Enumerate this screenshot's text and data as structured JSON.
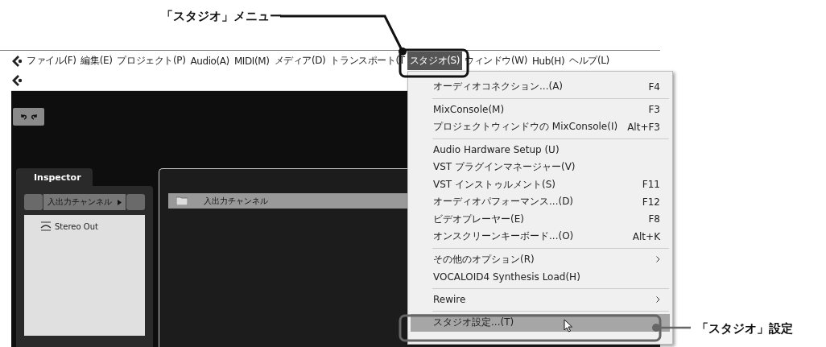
{
  "annotations": [
    {
      "text": "「スタジオ」メニュー"
    },
    {
      "text": "「スタジオ」設定"
    }
  ],
  "menubar": {
    "items": [
      {
        "label": "ファイル(F)",
        "selected": false
      },
      {
        "label": "編集(E)",
        "selected": false
      },
      {
        "label": "プロジェクト(P)",
        "selected": false
      },
      {
        "label": "Audio(A)",
        "selected": false
      },
      {
        "label": "MIDI(M)",
        "selected": false
      },
      {
        "label": "メディア(D)",
        "selected": false
      },
      {
        "label": "トランスポート(T",
        "selected": false
      },
      {
        "label": "スタジオ(S)",
        "selected": true
      },
      {
        "label": "ウィンドウ(W)",
        "selected": false
      },
      {
        "label": "Hub(H)",
        "selected": false
      },
      {
        "label": "ヘルプ(L)",
        "selected": false
      }
    ]
  },
  "inspector": {
    "tab": "Inspector",
    "channel_selector": "入出力チャンネル",
    "tree": [
      {
        "label": "Stereo Out"
      }
    ]
  },
  "project": {
    "folder_track": "入出力チャンネル"
  },
  "menu": {
    "sections": [
      [
        {
          "label": "オーディオコネクション...(A)",
          "shortcut": "F4",
          "submenu": false,
          "selected": false
        }
      ],
      [
        {
          "label": "MixConsole(M)",
          "shortcut": "F3",
          "submenu": false,
          "selected": false
        },
        {
          "label": "プロジェクトウィンドウの MixConsole(I)",
          "shortcut": "Alt+F3",
          "submenu": false,
          "selected": false
        }
      ],
      [
        {
          "label": "Audio Hardware Setup  (U)",
          "submenu": false,
          "selected": false
        },
        {
          "label": "VST プラグインマネージャー(V)",
          "submenu": false,
          "selected": false
        },
        {
          "label": "VST インストゥルメント(S)",
          "shortcut": "F11",
          "submenu": false,
          "selected": false
        },
        {
          "label": "オーディオパフォーマンス...(D)",
          "shortcut": "F12",
          "submenu": false,
          "selected": false
        },
        {
          "label": "ビデオプレーヤー(E)",
          "shortcut": "F8",
          "submenu": false,
          "selected": false
        },
        {
          "label": "オンスクリーンキーボード...(O)",
          "shortcut": "Alt+K",
          "submenu": false,
          "selected": false
        }
      ],
      [
        {
          "label": "その他のオプション(R)",
          "submenu": true,
          "selected": false
        },
        {
          "label": "VOCALOID4 Synthesis Load(H)",
          "submenu": false,
          "selected": false
        }
      ],
      [
        {
          "label": "Rewire",
          "submenu": true,
          "selected": false
        }
      ],
      [
        {
          "label": "スタジオ設定...(T)",
          "submenu": false,
          "selected": true
        }
      ]
    ]
  }
}
